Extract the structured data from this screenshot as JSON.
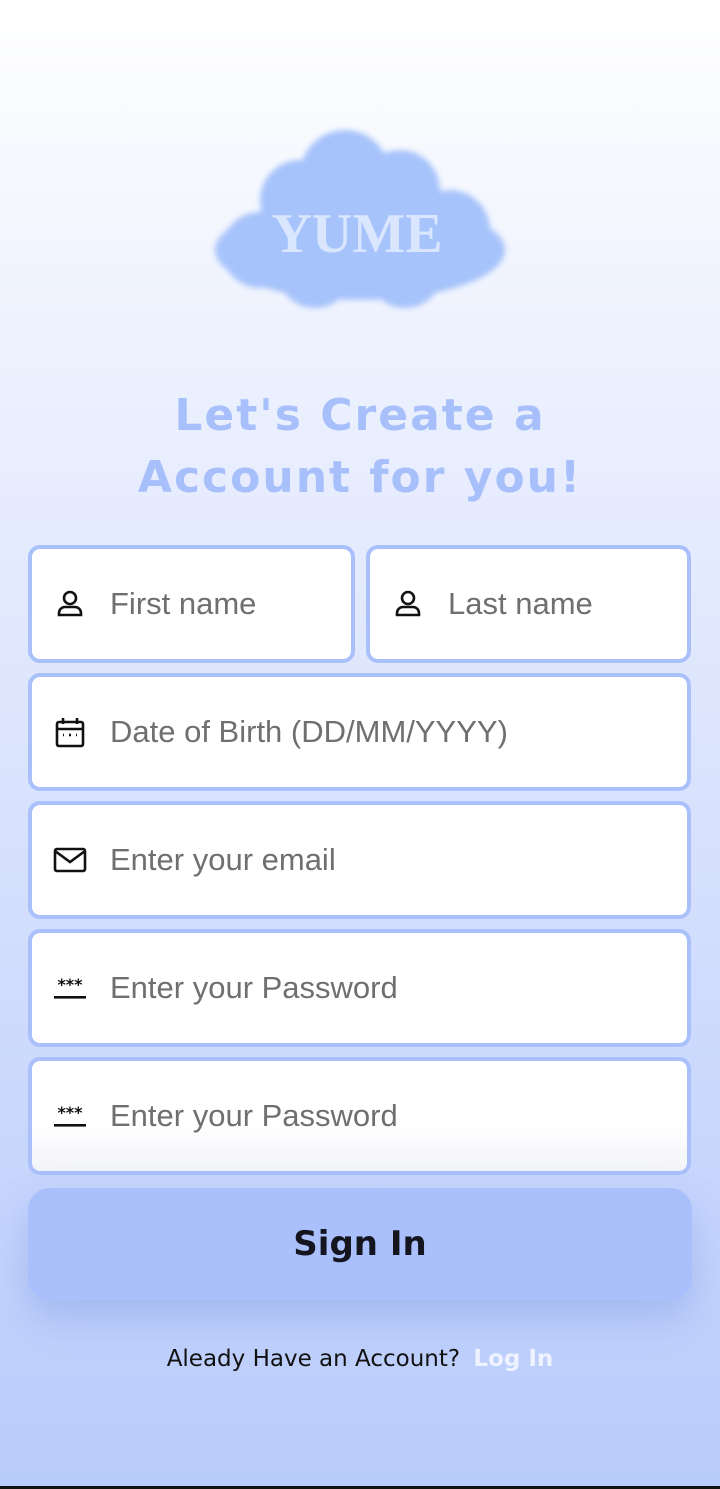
{
  "logo": {
    "text": "YUME"
  },
  "heading": {
    "line1": "Let's Create a",
    "line2": "Account for you!"
  },
  "form": {
    "first_name_placeholder": "First name",
    "last_name_placeholder": "Last name",
    "dob_placeholder": "Date of Birth (DD/MM/YYYY)",
    "email_placeholder": "Enter your email",
    "password_placeholder": "Enter your Password",
    "confirm_password_placeholder": "Enter your Password"
  },
  "icons": {
    "first_name": "person-icon",
    "last_name": "person-icon",
    "dob": "calendar-icon",
    "email": "mail-icon",
    "password": "password-icon",
    "confirm_password": "password-icon"
  },
  "button": {
    "label": "Sign In"
  },
  "footer": {
    "prompt": "Aleady Have an Account?",
    "link": "Log In"
  },
  "colors": {
    "accent": "#a9c0fb",
    "heading": "#a7bffb",
    "button": "#a9c0fd",
    "link": "#eef3ff"
  }
}
